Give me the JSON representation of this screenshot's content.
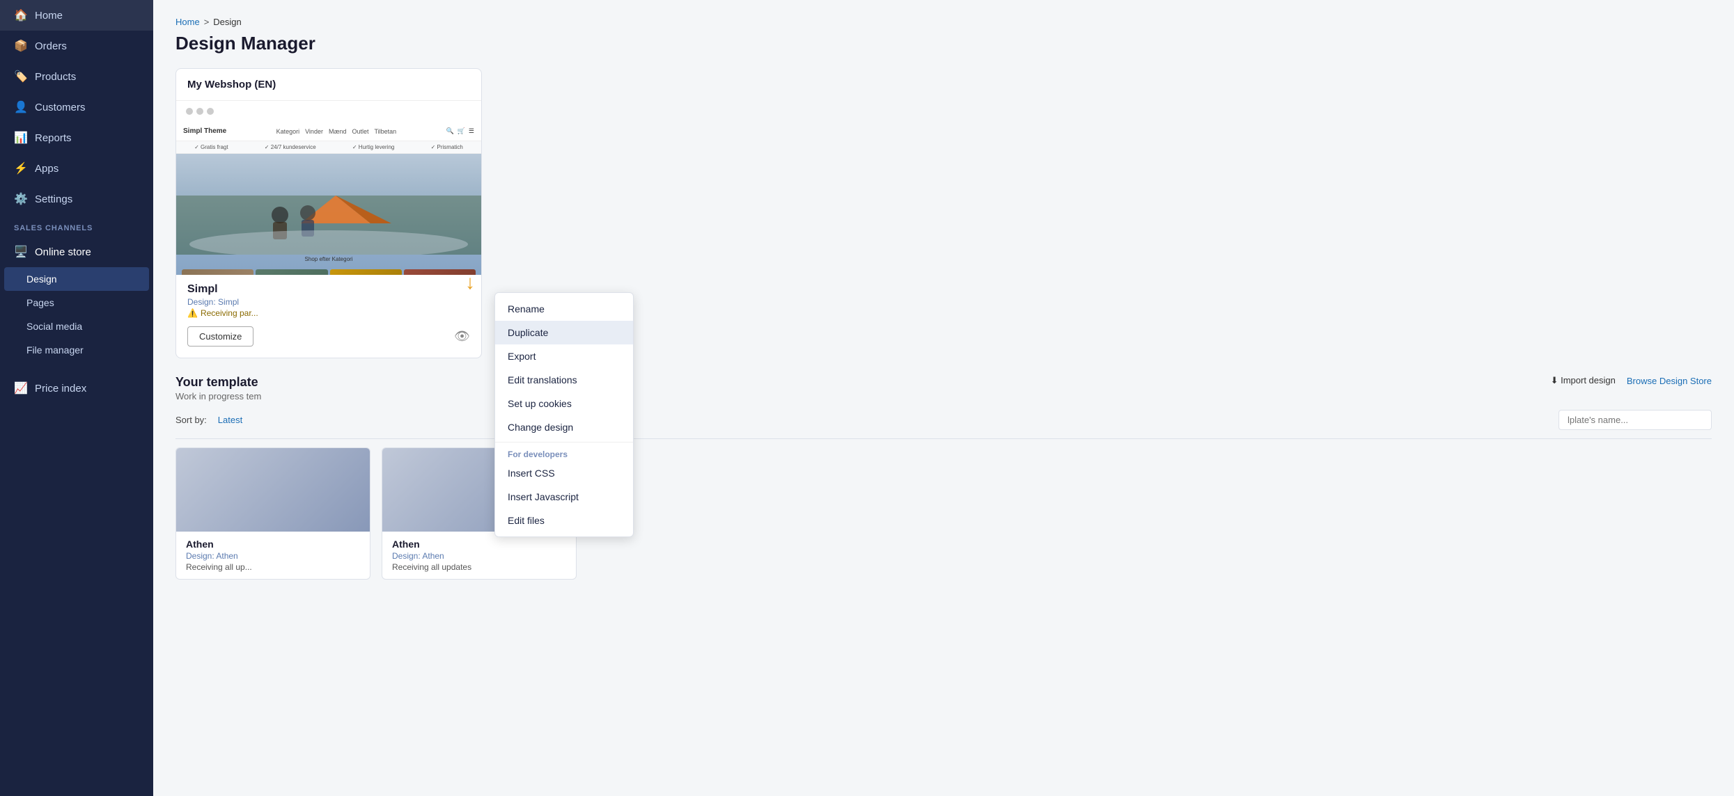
{
  "sidebar": {
    "items": [
      {
        "id": "home",
        "label": "Home",
        "icon": "🏠"
      },
      {
        "id": "orders",
        "label": "Orders",
        "icon": "📦"
      },
      {
        "id": "products",
        "label": "Products",
        "icon": "🏷️"
      },
      {
        "id": "customers",
        "label": "Customers",
        "icon": "👤"
      },
      {
        "id": "reports",
        "label": "Reports",
        "icon": "📊"
      },
      {
        "id": "apps",
        "label": "Apps",
        "icon": "⚙️"
      },
      {
        "id": "settings",
        "label": "Settings",
        "icon": "⚙️"
      }
    ],
    "sales_channels_label": "SALES CHANNELS",
    "sub_items": [
      {
        "id": "online-store",
        "label": "Online store",
        "icon": "🖥️"
      },
      {
        "id": "design",
        "label": "Design",
        "active": true
      },
      {
        "id": "pages",
        "label": "Pages"
      },
      {
        "id": "social-media",
        "label": "Social media"
      },
      {
        "id": "file-manager",
        "label": "File manager"
      }
    ],
    "bottom_items": [
      {
        "id": "price-index",
        "label": "Price index",
        "icon": "📈"
      }
    ]
  },
  "breadcrumb": {
    "home": "Home",
    "separator": ">",
    "current": "Design"
  },
  "page": {
    "title": "Design Manager"
  },
  "my_webshop_card": {
    "title": "My Webshop (EN)",
    "theme_brand": "Simpl Theme",
    "nav_links": [
      "Kategori",
      "Vinder",
      "Mænd",
      "Outlet",
      "Tilbetan"
    ],
    "trust_items": [
      "Gratis fragt",
      "24/7 kundeservice",
      "Hurtig levering",
      "Prismatich"
    ],
    "category_label": "Shop efter Kategori",
    "design_name": "Simpl",
    "design_label": "Design: Simpl",
    "status": "Receiving par...",
    "status_icon": "⚠️",
    "btn_customize": "Customize"
  },
  "context_menu": {
    "items": [
      {
        "label": "Rename",
        "section": false,
        "active": false
      },
      {
        "label": "Duplicate",
        "section": false,
        "active": true
      },
      {
        "label": "Export",
        "section": false,
        "active": false
      },
      {
        "label": "Edit translations",
        "section": false,
        "active": false
      },
      {
        "label": "Set up cookies",
        "section": false,
        "active": false
      },
      {
        "label": "Change design",
        "section": false,
        "active": false
      }
    ],
    "dev_section": "For developers",
    "dev_items": [
      {
        "label": "Insert CSS"
      },
      {
        "label": "Insert Javascript"
      },
      {
        "label": "Edit files"
      }
    ]
  },
  "templates_section": {
    "title": "Your template",
    "subtitle": "Work in progress tem",
    "btn_import": "Import design",
    "btn_browse": "Browse Design Store",
    "sort_label": "Sort by:",
    "sort_active": "Latest",
    "search_placeholder": "lplate's name...",
    "cards": [
      {
        "title": "Athen",
        "design_label": "Design: Athen",
        "status": "Receiving all up..."
      },
      {
        "title": "Athen",
        "design_label": "Design: Athen",
        "status": "Receiving all updates"
      }
    ]
  }
}
